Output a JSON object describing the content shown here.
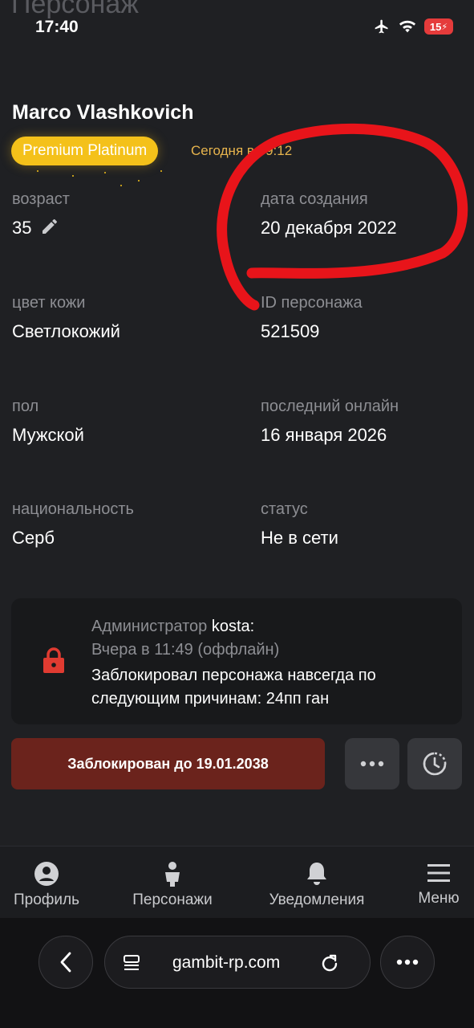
{
  "page": {
    "title": "Персонаж"
  },
  "status_bar": {
    "time": "17:40",
    "battery": "15"
  },
  "character": {
    "name": "Marco Vlashkovich",
    "premium_badge": "Premium Platinum",
    "last_seen_short": "Сегодня в 09:12"
  },
  "fields": {
    "age": {
      "label": "возраст",
      "value": "35"
    },
    "created": {
      "label": "дата создания",
      "value": "20 декабря 2022"
    },
    "skin": {
      "label": "цвет кожи",
      "value": "Светлокожий"
    },
    "id": {
      "label": "ID персонажа",
      "value": "521509"
    },
    "gender": {
      "label": "пол",
      "value": "Мужской"
    },
    "last_online": {
      "label": "последний онлайн",
      "value": "16 января 2026"
    },
    "nationality": {
      "label": "национальность",
      "value": "Серб"
    },
    "status": {
      "label": "статус",
      "value": "Не в сети"
    }
  },
  "ban_notice": {
    "admin_prefix": "Администратор",
    "admin_name": "kosta:",
    "time": "Вчера в 11:49 (оффлайн)",
    "reason": "Заблокировал персонажа навсегда по следующим причинам: 24пп ган"
  },
  "actions": {
    "blocked_label": "Заблокирован до 19.01.2038",
    "more_icon": "more-dots-icon",
    "history_icon": "history-clock-icon"
  },
  "bottom_nav": {
    "items": [
      {
        "label": "Профиль",
        "icon": "profile-icon"
      },
      {
        "label": "Персонажи",
        "icon": "character-icon"
      },
      {
        "label": "Уведомления",
        "icon": "bell-icon"
      },
      {
        "label": "Меню",
        "icon": "menu-icon"
      }
    ]
  },
  "browser": {
    "url": "gambit-rp.com"
  },
  "colors": {
    "background": "#1f2023",
    "premium": "#f4c11a",
    "last_seen": "#e7b44d",
    "blocked_button": "#6b231c",
    "lock": "#e03b31",
    "annotation": "#e8141a"
  }
}
